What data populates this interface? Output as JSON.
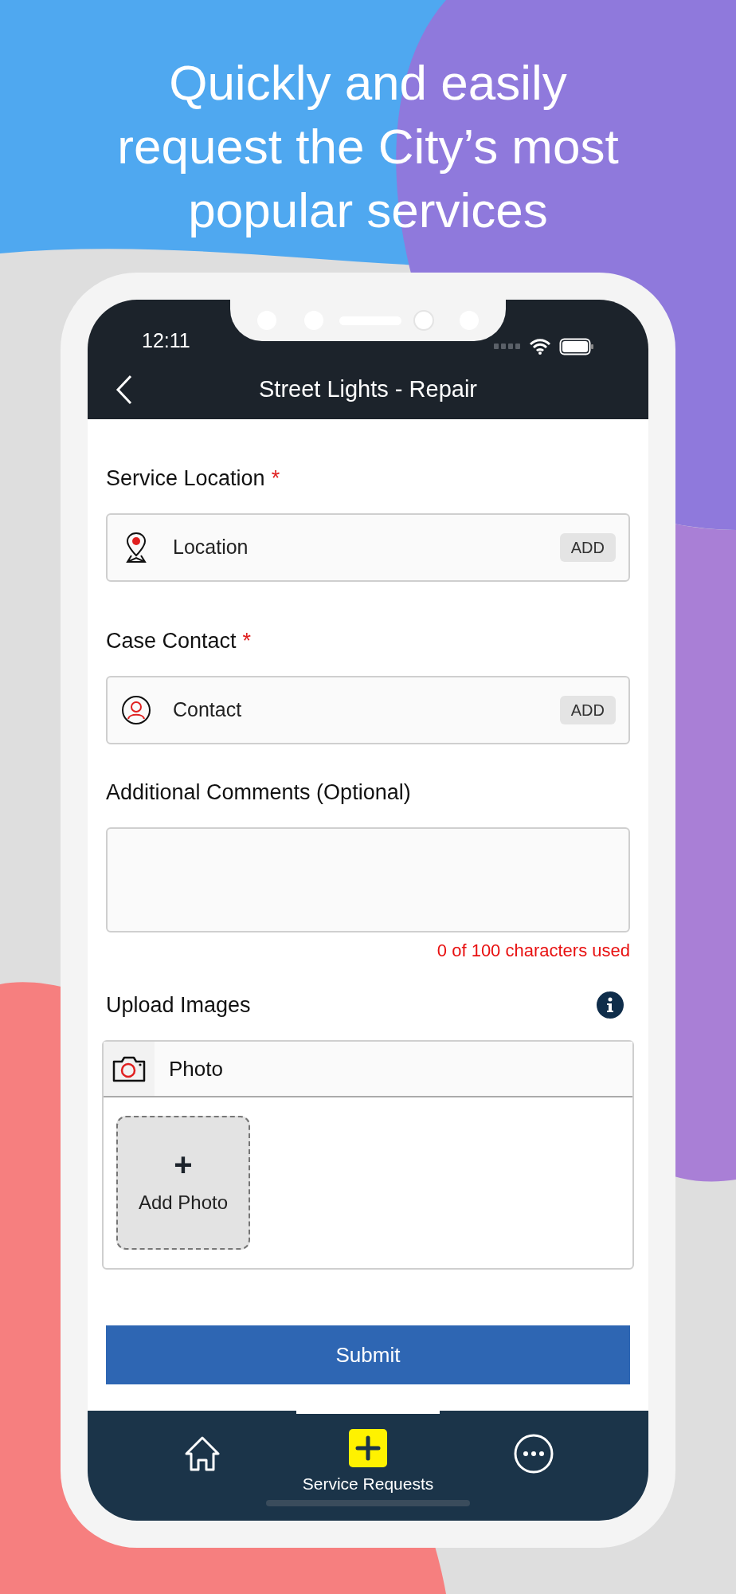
{
  "headline": [
    "Quickly and easily",
    "request the City’s most",
    "popular services"
  ],
  "status_bar": {
    "time": "12:11"
  },
  "nav_bar": {
    "title": "Street Lights - Repair"
  },
  "fields": [
    {
      "kind": "location",
      "label": "Service Location",
      "required": true,
      "placeholder": "Location",
      "action": "ADD"
    },
    {
      "kind": "contact",
      "label": "Case Contact",
      "required": true,
      "placeholder": "Contact",
      "action": "ADD"
    }
  ],
  "required_mark": "*",
  "comments": {
    "label": "Additional Comments (Optional)",
    "counter": "0 of 100 characters used"
  },
  "upload": {
    "label": "Upload Images",
    "header": "Photo",
    "add_icon": "+",
    "add_label": "Add Photo"
  },
  "submit": "Submit",
  "tab_bar": [
    {
      "kind": "home",
      "selected": false
    },
    {
      "kind": "add",
      "label": "Service Requests",
      "selected": true
    },
    {
      "kind": "more",
      "selected": false
    }
  ]
}
